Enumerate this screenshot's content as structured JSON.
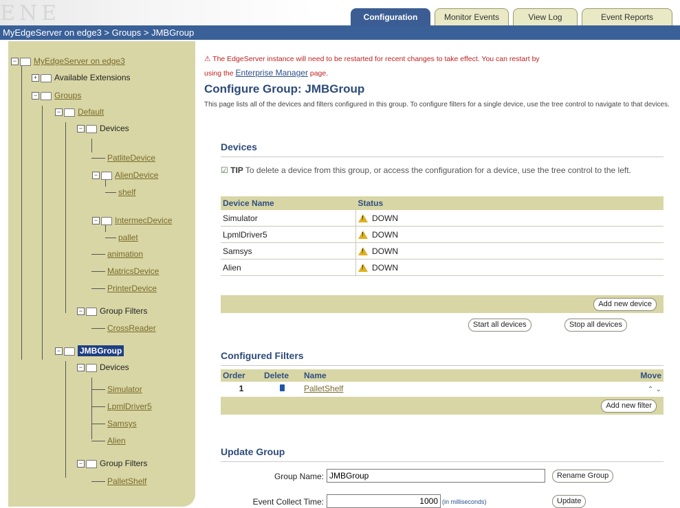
{
  "header": {
    "logo_text": "ENE",
    "tabs": [
      {
        "label": "Configuration",
        "active": true
      },
      {
        "label": "Monitor Events",
        "active": false
      },
      {
        "label": "View Log",
        "active": false
      },
      {
        "label": "Event Reports",
        "active": false
      }
    ]
  },
  "breadcrumb": "MyEdgeServer on edge3  >  Groups  >  JMBGroup",
  "tree": {
    "root": "MyEdgeServer on edge3",
    "available_extensions": "Available Extensions",
    "groups": "Groups",
    "default": "Default",
    "devices": "Devices",
    "patlite": "PatliteDevice",
    "alien_device": "AlienDevice",
    "shelf": "shelf",
    "intermec": "IntermecDevice",
    "pallet": "pallet",
    "animation": "animation",
    "matrics": "MatricsDevice",
    "printer": "PrinterDevice",
    "group_filters": "Group Filters",
    "cross_reader": "CrossReader",
    "jmbgroup": "JMBGroup",
    "jmb_devices": "Devices",
    "simulator": "Simulator",
    "lpml": "LpmlDriver5",
    "samsys": "Samsys",
    "alien": "Alien",
    "jmb_group_filters": "Group Filters",
    "pallet_shelf": "PalletShelf"
  },
  "warning": {
    "text1": "The EdgeServer instance will need to be restarted for recent changes to take effect. You can restart by",
    "text2": "using the",
    "link": "Enterprise Manager",
    "text3": "page."
  },
  "page": {
    "title": "Configure Group: JMBGroup",
    "description": "This page lists all of the devices and filters configured in this group. To configure filters for a single device, use the tree control to navigate to that devices."
  },
  "devices": {
    "title": "Devices",
    "tip_label": "TIP",
    "tip_text": "To delete a device from this group, or access the configuration for a device, use the tree control to the left.",
    "col_name": "Device Name",
    "col_status": "Status",
    "rows": [
      {
        "name": "Simulator",
        "status": "DOWN"
      },
      {
        "name": "LpmlDriver5",
        "status": "DOWN"
      },
      {
        "name": "Samsys",
        "status": "DOWN"
      },
      {
        "name": "Alien",
        "status": "DOWN"
      }
    ],
    "add_label": "Add new device",
    "start_label": "Start all devices",
    "stop_label": "Stop all devices"
  },
  "filters": {
    "title": "Configured Filters",
    "col_order": "Order",
    "col_delete": "Delete",
    "col_name": "Name",
    "col_move": "Move",
    "rows": [
      {
        "order": "1",
        "name": "PalletShelf"
      }
    ],
    "add_label": "Add new filter"
  },
  "update": {
    "title": "Update Group",
    "name_label": "Group Name:",
    "name_value": "JMBGroup",
    "rename_label": "Rename Group",
    "collect_label": "Event Collect Time:",
    "collect_value": "1000",
    "collect_unit": "(in milliseconds)",
    "update_label": "Update"
  },
  "colors": {
    "brand_blue": "#3a6098",
    "sidebar": "#d8d6a5",
    "warning_red": "#c02020"
  }
}
